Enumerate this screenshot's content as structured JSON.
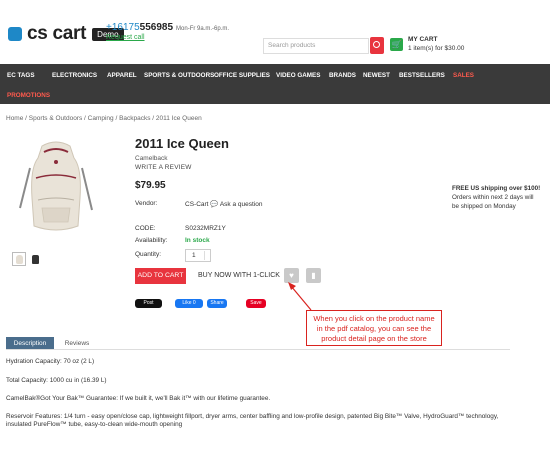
{
  "header": {
    "logo_text": "cs cart",
    "demo_badge": "Demo",
    "phone_prefix": "+16175",
    "phone_number": "556985",
    "hours": "Mon-Fr 9a.m.-6p.m.",
    "request_call": "Request call",
    "search_placeholder": "Search products",
    "cart_title": "MY CART",
    "cart_summary": "1 item(s) for $30.00"
  },
  "nav": {
    "items": [
      "EC TAGS",
      "ELECTRONICS",
      "APPAREL",
      "SPORTS & OUTDOORS",
      "OFFICE SUPPLIES",
      "VIDEO GAMES",
      "BRANDS",
      "NEWEST",
      "BESTSELLERS",
      "SALES"
    ],
    "items_row2": [
      "PROMOTIONS"
    ]
  },
  "breadcrumb": "Home / Sports & Outdoors / Camping / Backpacks / 2011 Ice Queen",
  "product": {
    "title": "2011 Ice Queen",
    "brand": "Camelback",
    "write_review": "WRITE A REVIEW",
    "price": "$79.95",
    "vendor_label": "Vendor:",
    "vendor_value": "CS-Cart",
    "ask_question": "Ask a question",
    "code_label": "CODE:",
    "code_value": "S0232MRZ1Y",
    "availability_label": "Availability:",
    "availability_value": "In stock",
    "quantity_label": "Quantity:",
    "quantity_value": "1",
    "add_to_cart": "ADD TO CART",
    "buy_now": "BUY NOW WITH 1-CLICK"
  },
  "shipping": {
    "title": "FREE US shipping over $100!",
    "line1": "Orders within next 2 days will",
    "line2": "be shipped on Monday"
  },
  "social": {
    "post": "Post",
    "like": "Like 0",
    "share": "Share",
    "save": "Save"
  },
  "annotation": {
    "line1": "When you click on the product name",
    "line2": "in the pdf catalog, you can see the",
    "line3": "product detail page on the store"
  },
  "tabs": [
    "Description",
    "Reviews"
  ],
  "description": [
    "Hydration Capacity: 70 oz (2 L)",
    "Total Capacity: 1000 cu in (16.39 L)",
    "CamelBak®Got Your Bak™ Guarantee: If we built it, we'll Bak it™ with our lifetime guarantee.",
    "Reservoir Features: 1/4 turn - easy open/close cap, lightweight fillport, dryer arms, center baffling and low-profile design, patented Big Bite™ Valve, HydroGuard™ technology,",
    "insulated PureFlow™ tube, easy-to-clean wide-mouth opening"
  ],
  "colors": {
    "accent_red": "#e8343e",
    "nav_bg": "#3a3a3a",
    "green": "#2aa84a",
    "tab_active": "#4a6d8c"
  }
}
